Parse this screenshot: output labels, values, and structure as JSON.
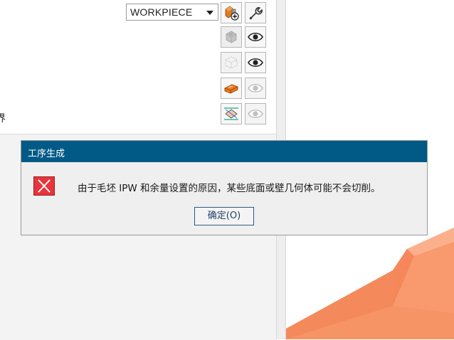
{
  "panel": {
    "cutoff_text": "界",
    "geometry_select": {
      "value": "WORKPIECE"
    },
    "toolbar": {
      "new_geometry_icon": "new-geometry-icon",
      "edit_icon": "wrench-icon",
      "part_icon": "part-body-icon",
      "blank_icon": "blank-body-icon",
      "check_icon": "check-body-icon",
      "fixture_icon": "fixture-body-icon",
      "display_icon": "eye-icon"
    }
  },
  "dialog": {
    "title": "工序生成",
    "message": "由于毛坯 IPW 和余量设置的原因，某些底面或壁几何体可能不会切削。",
    "ok_label": "确定(O)",
    "icon": "error-icon"
  },
  "colors": {
    "title_bar": "#005a85",
    "error_red": "#e8343c",
    "model_orange": "#f79465"
  }
}
